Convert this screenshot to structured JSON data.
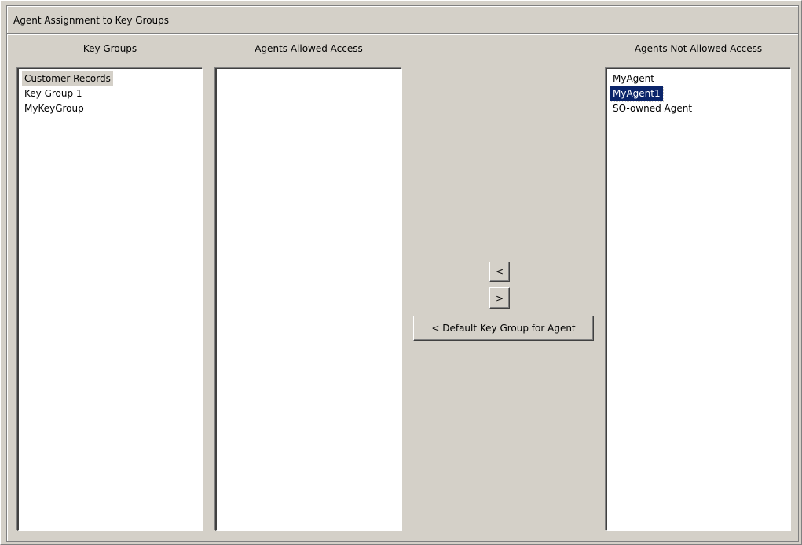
{
  "panel": {
    "title": "Agent Assignment to Key Groups"
  },
  "key_groups": {
    "label": "Key Groups",
    "items": [
      "Customer Records",
      "Key Group 1",
      "MyKeyGroup"
    ]
  },
  "agents_allowed": {
    "label": "Agents Allowed Access",
    "items": []
  },
  "agents_not_allowed": {
    "label": "Agents Not Allowed Access",
    "items": [
      "MyAgent",
      "MyAgent1",
      "SO-owned Agent"
    ]
  },
  "buttons": {
    "move_left": "<",
    "move_right": ">",
    "default_key_group": "< Default Key Group for Agent"
  },
  "colors": {
    "background": "#d4d0c8",
    "selection": "#0a246a"
  }
}
